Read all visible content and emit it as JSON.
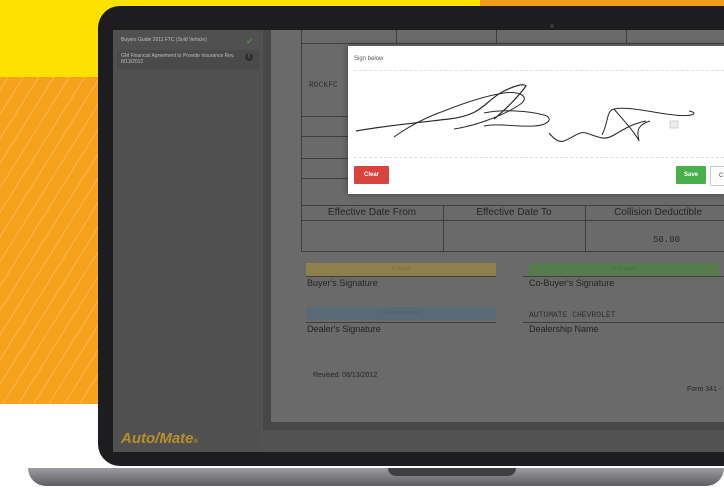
{
  "sidebar": {
    "items": [
      {
        "label": "Buyers Guide 2011 FTC (Sold Vehicle)",
        "status_icon": "check-icon"
      },
      {
        "label": "GM Financial Agreement to Provide Insurance Rev. 8/13/2012",
        "status_icon": "info-icon"
      }
    ],
    "brand": "Auto/Mate",
    "brand_suffix": "®"
  },
  "document": {
    "company_text": "ROCKFC",
    "headers": [
      "Effective Date From",
      "Effective Date To",
      "Collision Deductible"
    ],
    "collision_value": "50.00",
    "tags": {
      "buyer": "☑ Buyer",
      "cobuyer": "☑ Cobuyer",
      "representative": "☑ Representative"
    },
    "labels": {
      "buyer_signature": "Buyer's Signature",
      "cobuyer_signature": "Co-Buyer's Signature",
      "dealer_signature": "Dealer's Signature",
      "dealership_name": "Dealership Name",
      "dealership_value": "AUTOMATE CHEVROLET"
    },
    "revised": "Revised: 08/13/2012",
    "form_number": "Form 341 -"
  },
  "modal": {
    "title": "Sign below",
    "clear_label": "Clear",
    "save_label": "Save",
    "cancel_label": "C"
  },
  "colors": {
    "accent_yellow": "#fde100",
    "accent_orange": "#f6a21d",
    "clear_red": "#d9433e",
    "save_green": "#48b04a"
  }
}
